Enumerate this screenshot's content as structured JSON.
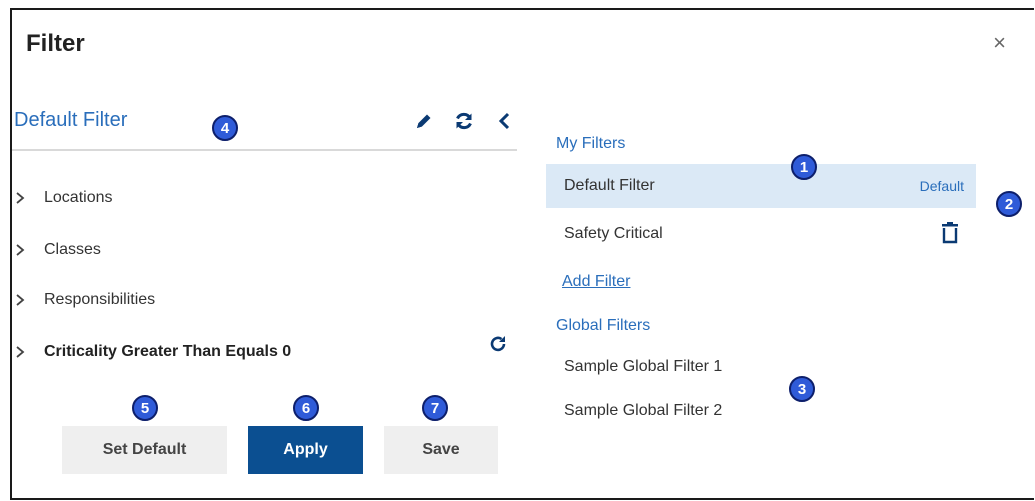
{
  "dialog": {
    "title": "Filter",
    "close_glyph": "×"
  },
  "left_pane": {
    "filter_name": "Default Filter",
    "toolbar": [
      "pencil-icon",
      "refresh-icon",
      "chevron-left-icon"
    ],
    "criteria": [
      {
        "label": "Locations",
        "bold": false
      },
      {
        "label": "Classes",
        "bold": false
      },
      {
        "label": "Responsibilities",
        "bold": false
      },
      {
        "label": "Criticality Greater Than Equals 0",
        "bold": true
      }
    ],
    "buttons": {
      "set_default": "Set Default",
      "apply": "Apply",
      "save": "Save"
    }
  },
  "right_pane": {
    "my_filters_heading": "My Filters",
    "my_filters": [
      {
        "name": "Default Filter",
        "tag": "Default",
        "selected": true
      },
      {
        "name": "Safety Critical",
        "tag": "",
        "selected": false
      }
    ],
    "add_filter_label": "Add Filter",
    "global_filters_heading": "Global Filters",
    "global_filters": [
      "Sample Global Filter 1",
      "Sample Global Filter 2"
    ]
  },
  "callouts": [
    "1",
    "2",
    "3",
    "4",
    "5",
    "6",
    "7"
  ],
  "colors": {
    "accent_blue": "#2a6ebb",
    "primary_button": "#0b4f91",
    "selected_row": "#dbe9f6",
    "callout_fill": "#2f5bd8"
  }
}
